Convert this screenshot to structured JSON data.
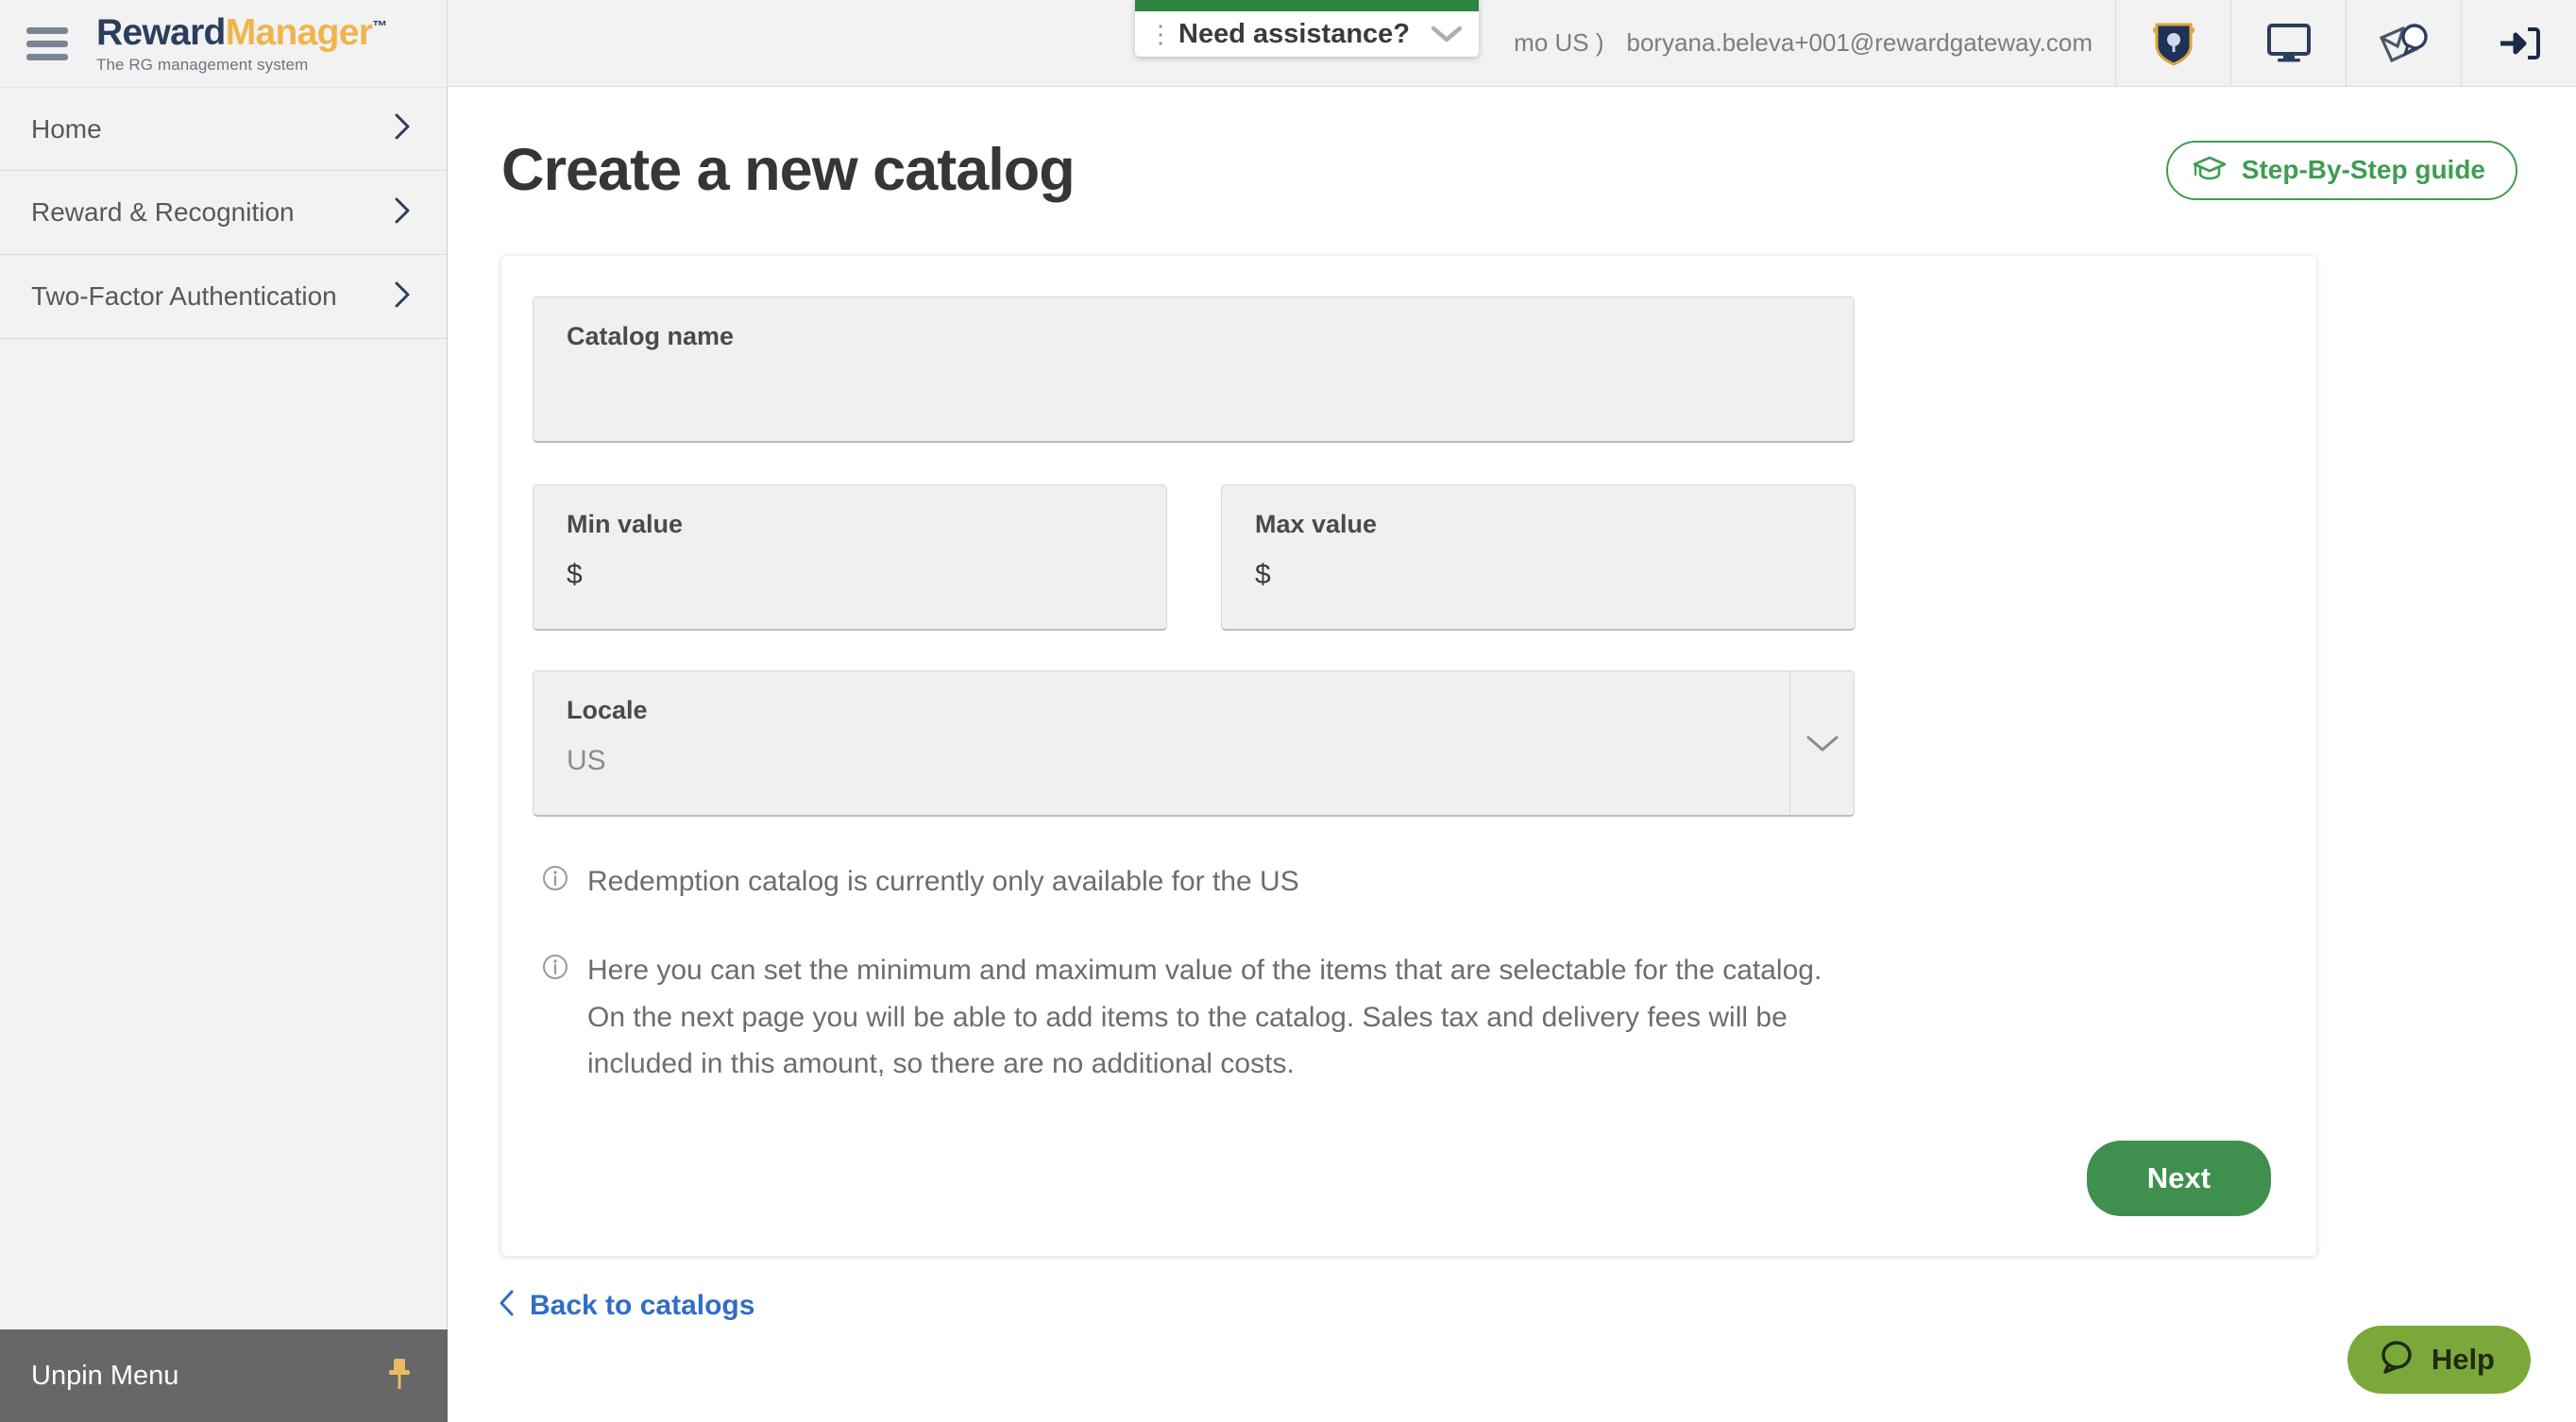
{
  "brand": {
    "name_first": "Reward",
    "name_second": "Manager",
    "trademark": "™",
    "tagline": "The RG management system"
  },
  "topbar": {
    "account_context": "mo US )",
    "user_email": "boryana.beleva+001@rewardgateway.com",
    "icons": [
      {
        "name": "shield-badge-icon",
        "title": "Badges"
      },
      {
        "name": "monitor-icon",
        "title": "Preview"
      },
      {
        "name": "mail-feedback-icon",
        "title": "Messages"
      },
      {
        "name": "logout-icon",
        "title": "Log out"
      }
    ],
    "assistance": {
      "label": "Need assistance?",
      "grip": "⋮",
      "accent_color": "#2e8540"
    }
  },
  "sidebar": {
    "items": [
      {
        "label": "Home"
      },
      {
        "label": "Reward & Recognition"
      },
      {
        "label": "Two-Factor Authentication"
      }
    ],
    "unpin_label": "Unpin Menu"
  },
  "main": {
    "page_title": "Create a new catalog",
    "guide_button": "Step-By-Step guide",
    "form": {
      "catalog_name": {
        "label": "Catalog name",
        "value": ""
      },
      "min_value": {
        "label": "Min value",
        "prefix": "$",
        "value": ""
      },
      "max_value": {
        "label": "Max value",
        "prefix": "$",
        "value": ""
      },
      "locale": {
        "label": "Locale",
        "value": "US"
      }
    },
    "hints": [
      "Redemption catalog is currently only available for the US",
      "Here you can set the minimum and maximum value of the items that are selectable for the catalog. On the next page you will be able to add items to the catalog. Sales tax and delivery fees will be included in this amount, so there are no additional costs."
    ],
    "next_button": "Next",
    "back_link": "Back to catalogs"
  },
  "help_widget": {
    "label": "Help",
    "color": "#7ba83a"
  },
  "colors": {
    "brand_navy": "#2c3e5d",
    "brand_gold": "#f0b44c",
    "primary_green": "#3f8f4f",
    "link_blue": "#2f6ec4"
  }
}
